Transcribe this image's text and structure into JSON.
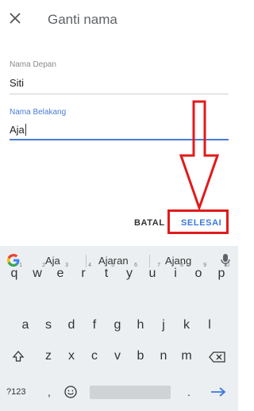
{
  "header": {
    "title": "Ganti nama",
    "close_icon": "close-icon"
  },
  "form": {
    "first_name": {
      "label": "Nama Depan",
      "value": "Siti"
    },
    "last_name": {
      "label": "Nama Belakang",
      "value": "Aja"
    }
  },
  "actions": {
    "cancel": "BATAL",
    "done": "SELESAI"
  },
  "keyboard": {
    "suggestions": [
      "Aja",
      "Ajaran",
      "Ajang"
    ],
    "row1": [
      {
        "key": "q",
        "hint": "1"
      },
      {
        "key": "w",
        "hint": "2"
      },
      {
        "key": "e",
        "hint": "3"
      },
      {
        "key": "r",
        "hint": "4"
      },
      {
        "key": "t",
        "hint": "5"
      },
      {
        "key": "y",
        "hint": "6"
      },
      {
        "key": "u",
        "hint": "7"
      },
      {
        "key": "i",
        "hint": "8"
      },
      {
        "key": "o",
        "hint": "9"
      },
      {
        "key": "p",
        "hint": "0"
      }
    ],
    "row2": [
      "a",
      "s",
      "d",
      "f",
      "g",
      "h",
      "j",
      "k",
      "l"
    ],
    "row3": [
      "z",
      "x",
      "c",
      "v",
      "b",
      "n",
      "m"
    ],
    "symbols_key": "?123",
    "comma": ",",
    "period": "."
  },
  "colors": {
    "accent": "#4a7bd8",
    "annotation": "#e01b1b",
    "keyboard_bg": "#eceff1"
  }
}
